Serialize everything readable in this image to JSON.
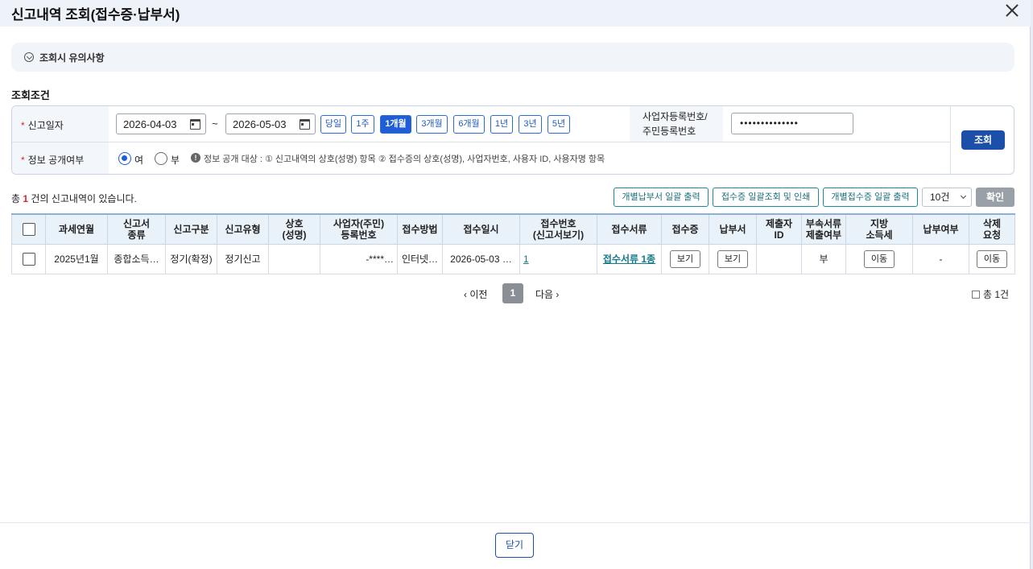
{
  "dialog": {
    "title": "신고내역 조회(접수증·납부서)"
  },
  "notice": {
    "label": "조회시 유의사항"
  },
  "conditions": {
    "section_title": "조회조건",
    "report_date_label": "신고일자",
    "start_date": "2026-04-03",
    "end_date": "2026-05-03",
    "range_sep": "~",
    "periods": [
      "당일",
      "1주",
      "1개월",
      "3개월",
      "6개월",
      "1년",
      "3년",
      "5년"
    ],
    "active_period": "1개월",
    "biz_no_label_1": "사업자등록번호/",
    "biz_no_label_2": "주민등록번호",
    "biz_no_value": "••••••••••••••",
    "search_label": "조회",
    "public_label": "정보 공개여부",
    "radio_yes": "여",
    "radio_no": "부",
    "public_selected": "여",
    "info_text": "정보 공개 대상 : ① 신고내역의 상호(성명) 항목 ② 접수증의 상호(성명), 사업자번호, 사용자 ID, 사용자명 항목"
  },
  "summary": {
    "prefix": "총",
    "count": "1",
    "suffix": "건의 신고내역이 있습니다."
  },
  "toolbar": {
    "btn_pay_print": "개별납부서 일괄 출력",
    "btn_receipt_view": "접수증 일괄조회 및 인쇄",
    "btn_receipt_print": "개별접수증 일괄 출력",
    "page_size": "10건",
    "confirm": "확인"
  },
  "table": {
    "headers": [
      [
        "과세연월"
      ],
      [
        "신고서",
        "종류"
      ],
      [
        "신고구분"
      ],
      [
        "신고유형"
      ],
      [
        "상호",
        "(성명)"
      ],
      [
        "사업자(주민)",
        "등록번호"
      ],
      [
        "접수방법"
      ],
      [
        "접수일시"
      ],
      [
        "접수번호",
        "(신고서보기)"
      ],
      [
        "접수서류"
      ],
      [
        "접수증"
      ],
      [
        "납부서"
      ],
      [
        "제출자",
        "ID"
      ],
      [
        "부속서류",
        "제출여부"
      ],
      [
        "지방",
        "소득세"
      ],
      [
        "납부여부"
      ],
      [
        "삭제",
        "요청"
      ]
    ],
    "rows": [
      {
        "period": "2025년1월",
        "type": "종합소득…",
        "category": "정기(확정)",
        "kind": "정기신고",
        "name": "",
        "reg_no": "-****…",
        "method": "인터넷…",
        "datetime": "2026-05-03 …",
        "receipt_no": "1",
        "docs": "접수서류 1종",
        "receipt_btn": "보기",
        "payment_btn": "보기",
        "submitter": "",
        "attached": "부",
        "local_tax_btn": "이동",
        "paid": "-",
        "delete_btn": "이동"
      }
    ]
  },
  "pagination": {
    "prev": "이전",
    "current": "1",
    "next": "다음",
    "total": "총 1건"
  },
  "footer": {
    "close": "닫기"
  }
}
